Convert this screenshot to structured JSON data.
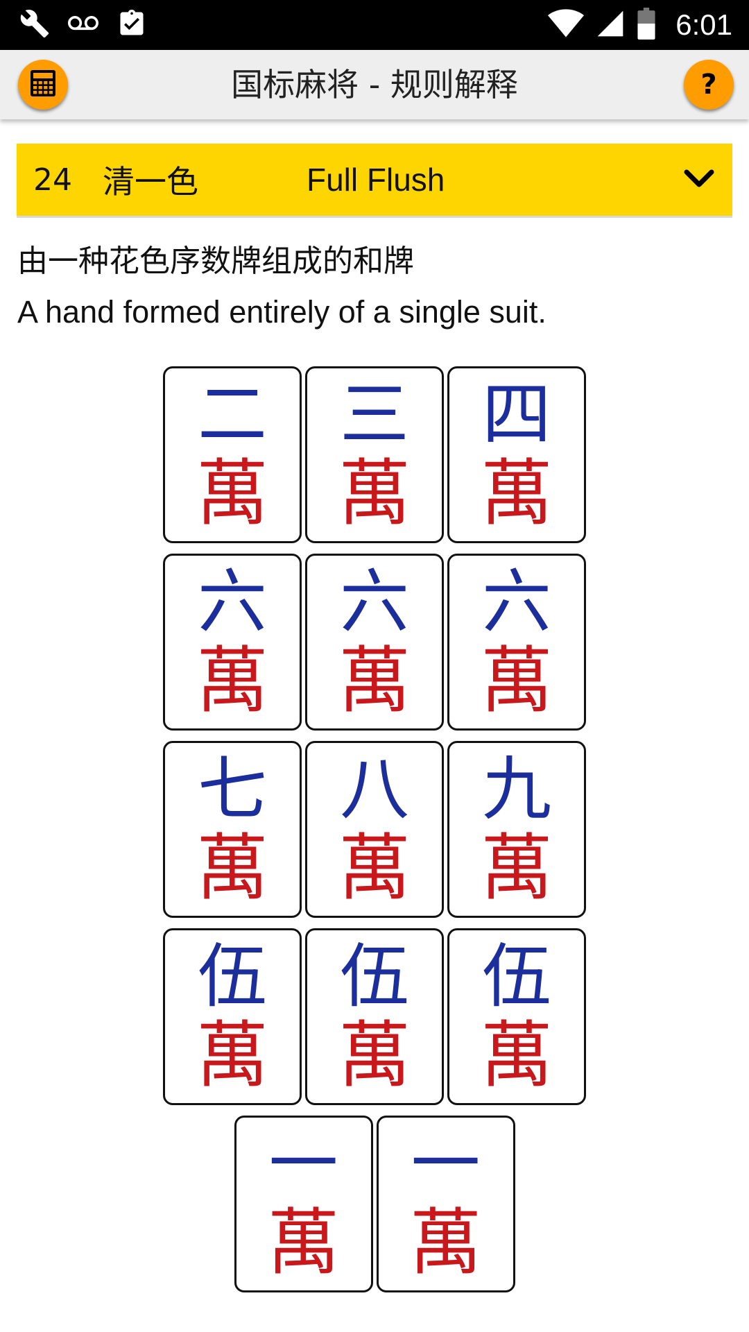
{
  "status_bar": {
    "time": "6:01",
    "icons": [
      "wrench-icon",
      "voicemail-icon",
      "clipboard-check-icon",
      "wifi-icon",
      "signal-icon",
      "battery-icon"
    ]
  },
  "app_bar": {
    "title": "国标麻将 - 规则解释",
    "left_button_icon": "calculator-icon",
    "right_button_label": "?",
    "accent_color": "#ff9d00"
  },
  "rule": {
    "number": "24",
    "name_zh": "清一色",
    "name_en": "Full Flush",
    "header_color": "#ffd500",
    "description_zh": "由一种花色序数牌组成的和牌",
    "description_en": "A hand formed entirely of a single suit."
  },
  "tiles": {
    "suit_char": "萬",
    "rank_color": "#1c2e9c",
    "suit_color": "#c8181c",
    "rows": [
      [
        "二",
        "三",
        "四"
      ],
      [
        "六",
        "六",
        "六"
      ],
      [
        "七",
        "八",
        "九"
      ],
      [
        "伍",
        "伍",
        "伍"
      ],
      [
        "一",
        "一"
      ]
    ]
  }
}
